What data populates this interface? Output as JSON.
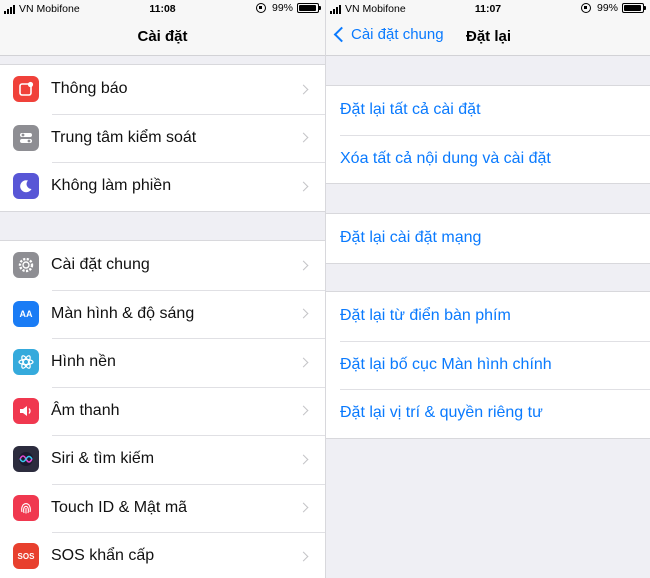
{
  "left": {
    "status": {
      "carrier": "VN Mobifone",
      "time": "11:08",
      "battery": "99%"
    },
    "nav_title": "Cài đặt",
    "groups": [
      [
        {
          "label": "Thông báo",
          "icon": "notifications-icon",
          "color": "#f0413a"
        },
        {
          "label": "Trung tâm kiểm soát",
          "icon": "control-center-icon",
          "color": "#8e8e93"
        },
        {
          "label": "Không làm phiền",
          "icon": "moon-icon",
          "color": "#5856d6"
        }
      ],
      [
        {
          "label": "Cài đặt chung",
          "icon": "gear-icon",
          "color": "#8e8e93"
        },
        {
          "label": "Màn hình & độ sáng",
          "icon": "display-brightness-icon",
          "color": "#1a7cf5",
          "glyph": "AA"
        },
        {
          "label": "Hình nền",
          "icon": "wallpaper-icon",
          "color": "#35aadc"
        },
        {
          "label": "Âm thanh",
          "icon": "sound-icon",
          "color": "#f0384f"
        },
        {
          "label": "Siri & tìm kiếm",
          "icon": "siri-icon",
          "color": "#2c2c3e"
        },
        {
          "label": "Touch ID & Mật mã",
          "icon": "fingerprint-icon",
          "color": "#f0384f"
        },
        {
          "label": "SOS khẩn cấp",
          "icon": "sos-icon",
          "color": "#e8402e",
          "glyph": "SOS"
        }
      ]
    ]
  },
  "right": {
    "status": {
      "carrier": "VN Mobifone",
      "time": "11:07",
      "battery": "99%"
    },
    "back_label": "Cài đặt chung",
    "nav_title": "Đặt lại",
    "groups": [
      [
        "Đặt lại tất cả cài đặt",
        "Xóa tất cả nội dung và cài đặt"
      ],
      [
        "Đặt lại cài đặt mạng"
      ],
      [
        "Đặt lại từ điển bàn phím",
        "Đặt lại bố cục Màn hình chính",
        "Đặt lại vị trí & quyền riêng tư"
      ]
    ]
  }
}
